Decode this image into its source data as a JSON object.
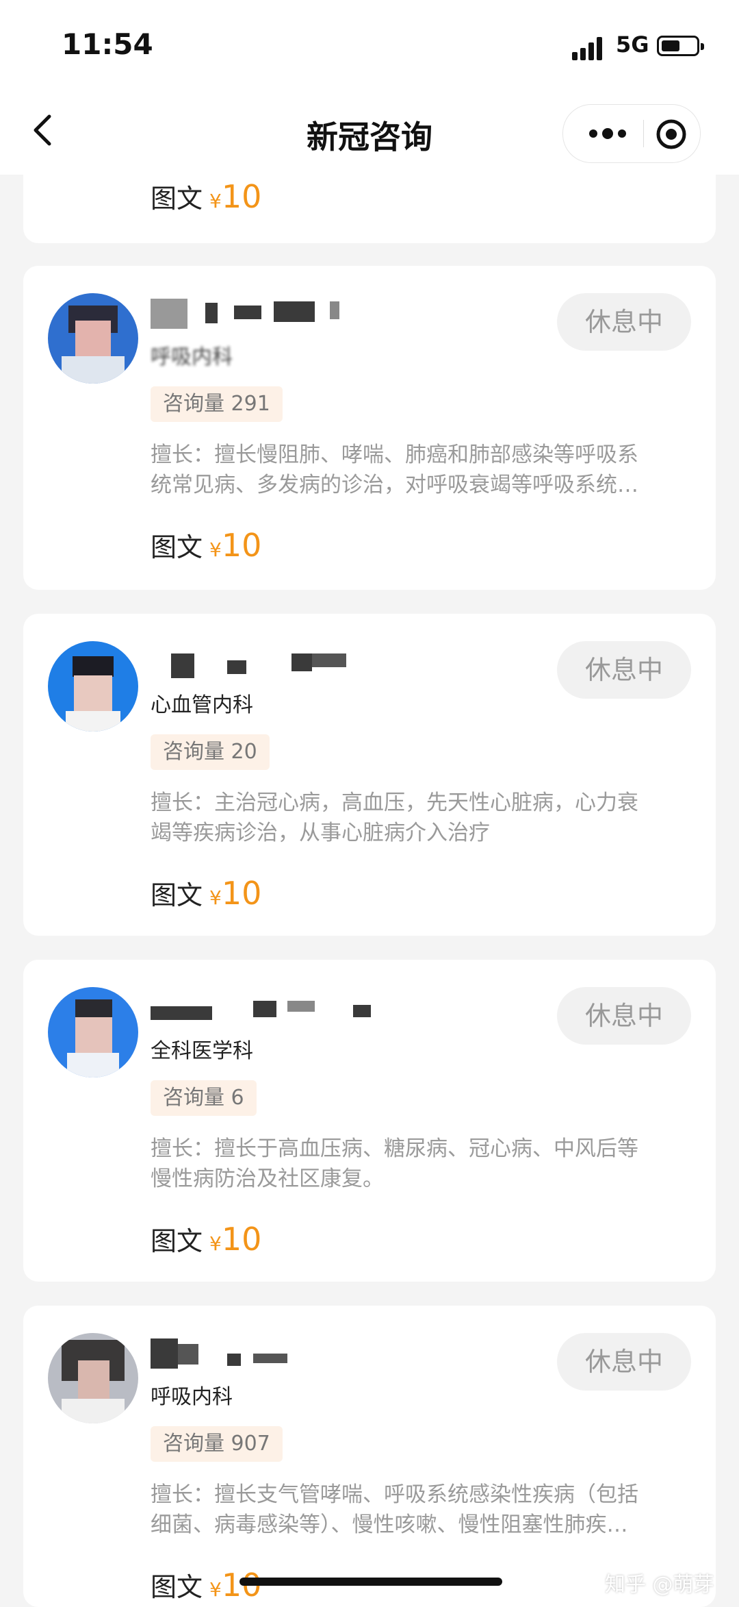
{
  "status_bar": {
    "time": "11:54",
    "network": "5G"
  },
  "nav": {
    "title": "新冠咨询"
  },
  "top_card": {
    "price_type": "图文",
    "currency": "¥",
    "price": "10"
  },
  "doctors": [
    {
      "department": "呼吸内科",
      "status": "休息中",
      "consult_label": "咨询量 291",
      "skill_line1": "擅长：擅长慢阻肺、哮喘、肺癌和肺部感染等呼吸系",
      "skill_line2": "统常见病、多发病的诊治，对呼吸衰竭等呼吸系统…",
      "price_type": "图文",
      "currency": "¥",
      "price": "10"
    },
    {
      "department": "心血管内科",
      "status": "休息中",
      "consult_label": "咨询量 20",
      "skill_line1": "擅长：主治冠心病，高血压，先天性心脏病，心力衰",
      "skill_line2": "竭等疾病诊治，从事心脏病介入治疗",
      "price_type": "图文",
      "currency": "¥",
      "price": "10"
    },
    {
      "department": "全科医学科",
      "status": "休息中",
      "consult_label": "咨询量 6",
      "skill_line1": "擅长：擅长于高血压病、糖尿病、冠心病、中风后等",
      "skill_line2": "慢性病防治及社区康复。",
      "price_type": "图文",
      "currency": "¥",
      "price": "10"
    },
    {
      "department": "呼吸内科",
      "status": "休息中",
      "consult_label": "咨询量 907",
      "skill_line1": "擅长：擅长支气管哮喘、呼吸系统感染性疾病（包括",
      "skill_line2": "细菌、病毒感染等）、慢性咳嗽、慢性阻塞性肺疾…",
      "price_type": "图文",
      "currency": "¥",
      "price": "10"
    }
  ],
  "watermark": "知乎 @萌芽",
  "colors": {
    "accent": "#f39418",
    "badge_bg": "#fdf1e7",
    "page_bg": "#f4f4f4"
  }
}
